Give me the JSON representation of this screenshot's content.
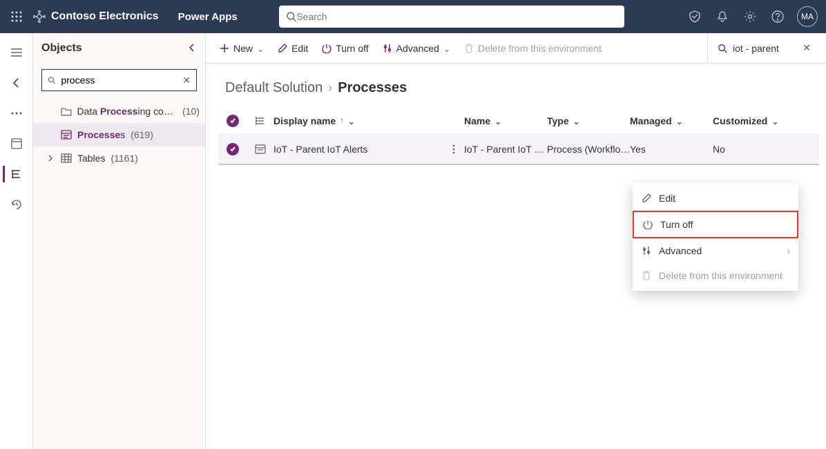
{
  "header": {
    "org": "Contoso Electronics",
    "app": "Power Apps",
    "search_placeholder": "Search",
    "avatar_initials": "MA"
  },
  "sidepanel": {
    "title": "Objects",
    "search_value": "process",
    "items": [
      {
        "pre": "Data ",
        "match": "Process",
        "post": "ing con…",
        "count": "(10)"
      },
      {
        "pre": "",
        "match": "Processe",
        "post": "s",
        "count": "(619)"
      },
      {
        "pre": "Tables",
        "match": "",
        "post": "",
        "count": "(1161)"
      }
    ]
  },
  "commands": {
    "new": "New",
    "edit": "Edit",
    "turnoff": "Turn off",
    "advanced": "Advanced",
    "delete": "Delete from this environment",
    "filter_value": "iot - parent"
  },
  "breadcrumb": {
    "root": "Default Solution",
    "current": "Processes"
  },
  "grid": {
    "headers": {
      "display": "Display name",
      "name": "Name",
      "type": "Type",
      "managed": "Managed",
      "customized": "Customized"
    },
    "row": {
      "display": "IoT - Parent IoT Alerts",
      "name": "IoT - Parent IoT …",
      "type": "Process (Workflo…",
      "managed": "Yes",
      "customized": "No"
    }
  },
  "context_menu": {
    "edit": "Edit",
    "turnoff": "Turn off",
    "advanced": "Advanced",
    "delete": "Delete from this environment"
  }
}
